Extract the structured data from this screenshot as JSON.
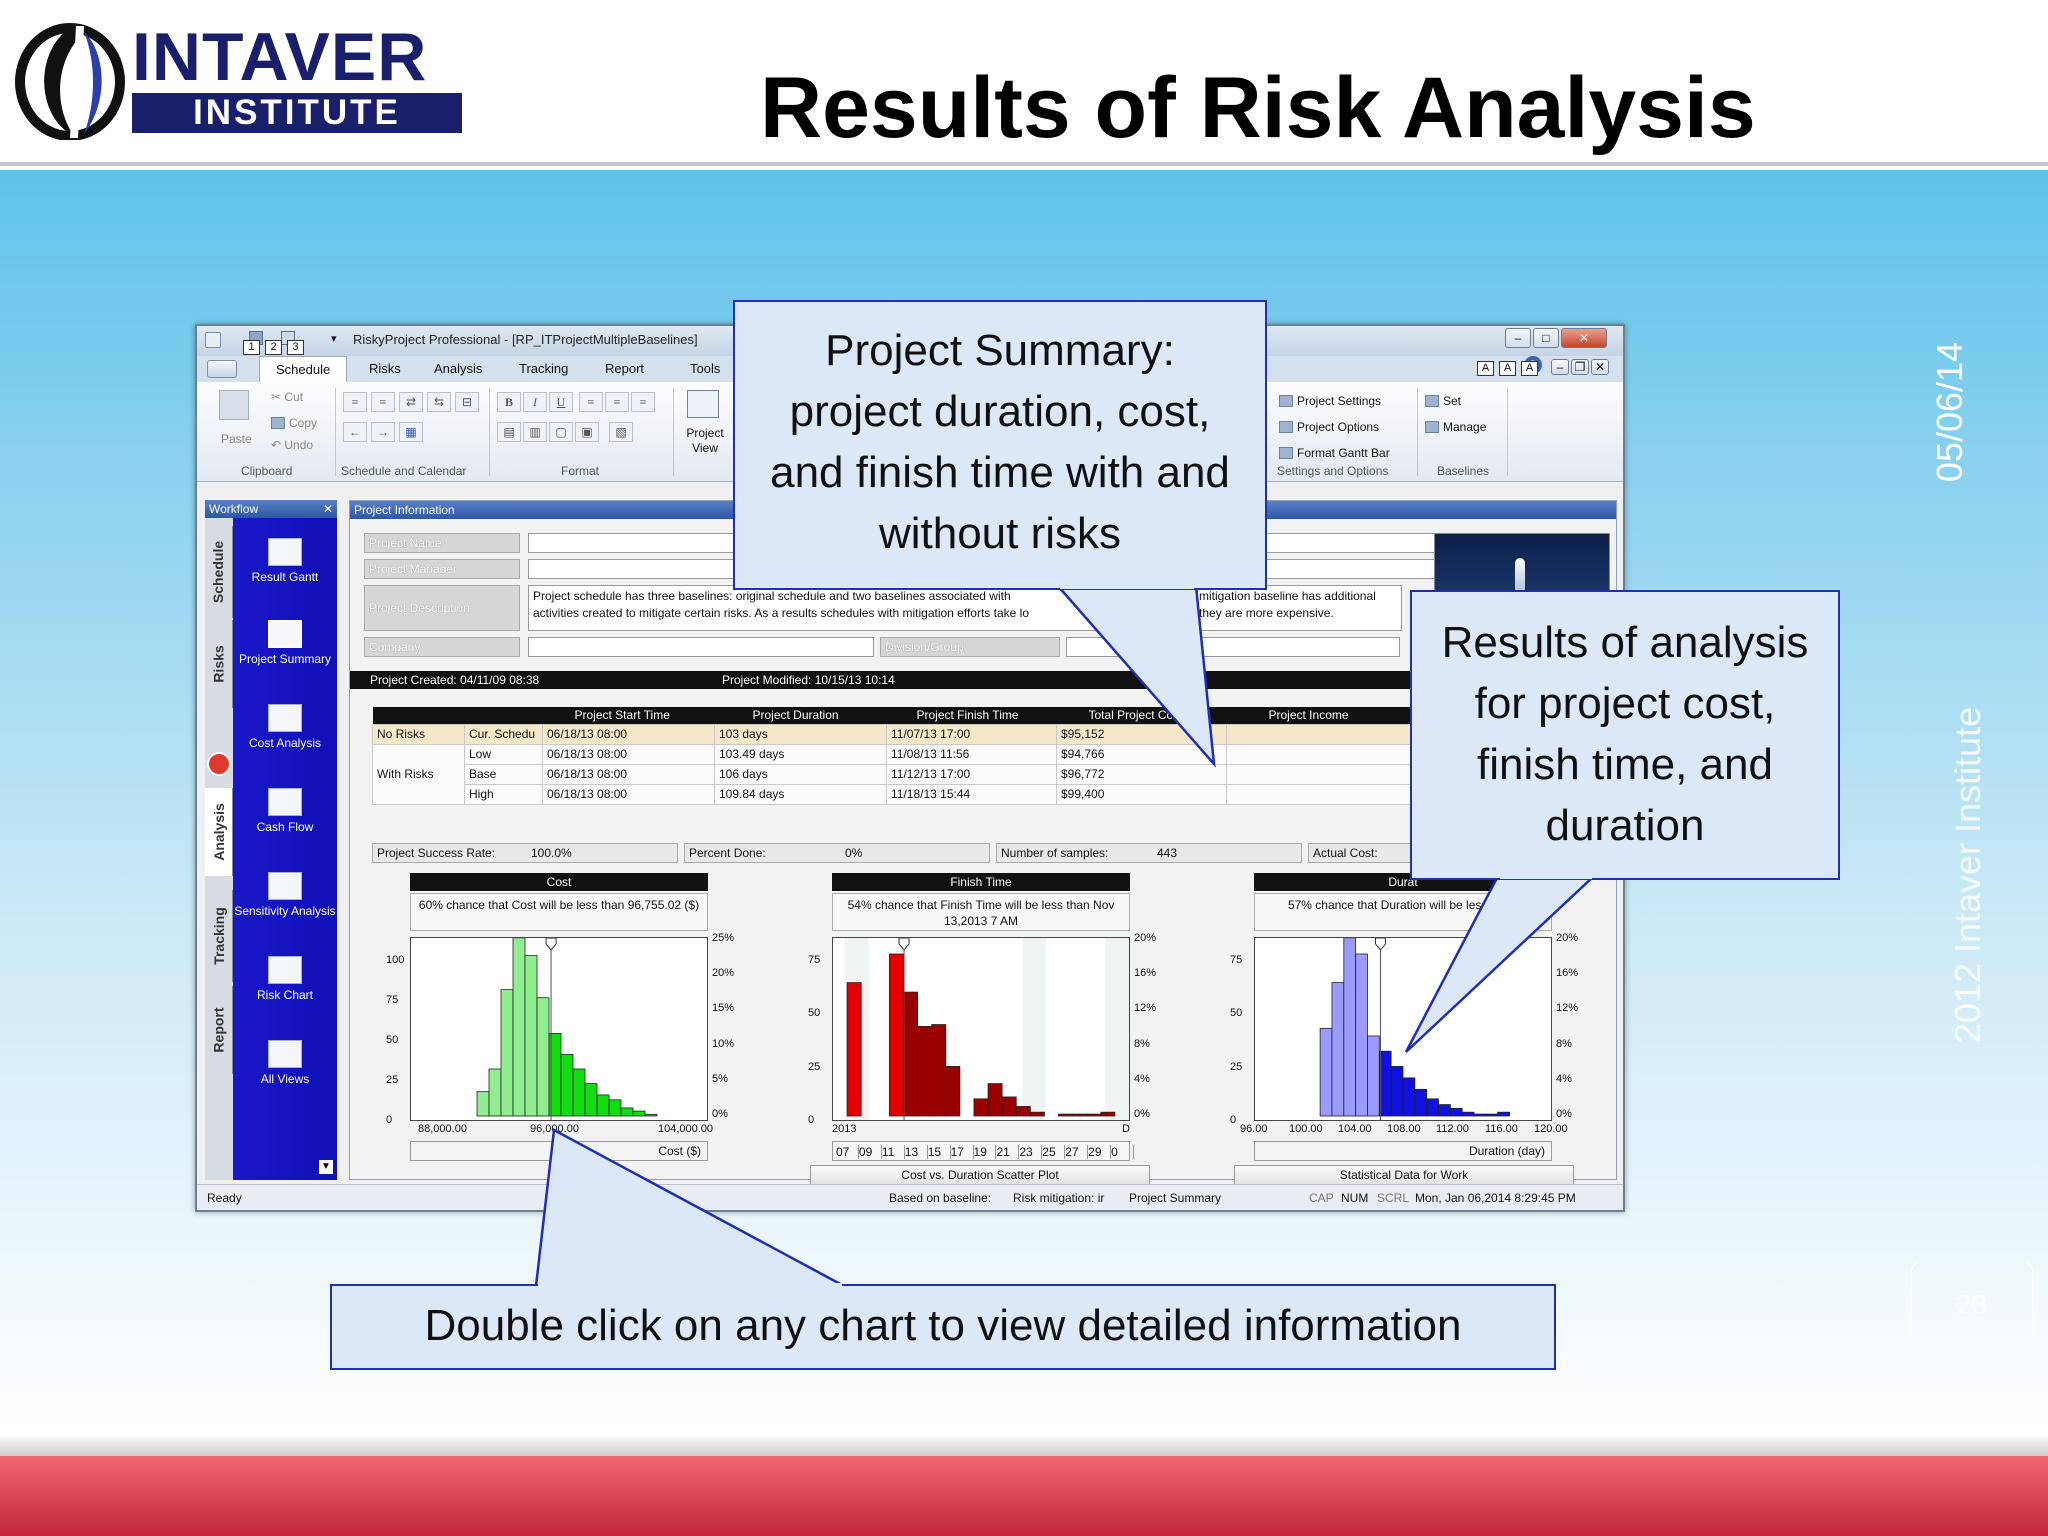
{
  "slide": {
    "title": "Results of Risk Analysis",
    "logo_top": "INTAVER",
    "logo_bottom": "INSTITUTE",
    "date": "05/06/14",
    "copyright": "2012 Intaver Institute",
    "page_number": "23"
  },
  "callouts": {
    "summary": "Project Summary: project duration, cost, and finish time with and without risks",
    "results": "Results of analysis for project cost, finish time, and duration",
    "double_click": "Double click on any chart to view detailed information"
  },
  "app": {
    "title": "RiskyProject Professional - [RP_ITProjectMultipleBaselines]",
    "quick_access": [
      "1",
      "2",
      "3"
    ],
    "window_controls": [
      "–",
      "□",
      "✕"
    ],
    "font_buttons": [
      "A",
      "A",
      "A"
    ],
    "tabs": [
      "Schedule",
      "Risks",
      "Analysis",
      "Tracking",
      "Report",
      "Tools"
    ],
    "ribbon": {
      "paste": "Paste",
      "cut": "Cut",
      "copy": "Copy",
      "undo": "Undo",
      "clipboard": "Clipboard",
      "schedule_calendar": "Schedule and Calendar",
      "format": "Format",
      "bold": "B",
      "italic": "I",
      "underline": "U",
      "project_view": "Project View",
      "project_settings": "Project Settings",
      "project_options": "Project Options",
      "format_gantt": "Format Gantt Bar",
      "settings_options": "Settings and Options",
      "set": "Set",
      "manage": "Manage",
      "baselines": "Baselines"
    },
    "workflow": {
      "header": "Workflow",
      "close": "✕",
      "tabs": [
        "Schedule",
        "Risks",
        "Analysis",
        "Tracking",
        "Report"
      ],
      "items": [
        "Result Gantt",
        "Project Summary",
        "Cost Analysis",
        "Cash Flow",
        "Sensitivity Analysis",
        "Risk Chart",
        "All Views"
      ]
    },
    "project_info": {
      "header": "Project Information",
      "project_name_label": "Project Name",
      "project_manager_label": "Project Manager",
      "project_description_label": "Project Description",
      "description_line1": "Project schedule has three baselines: original schedule and two baselines associated with",
      "description_line1b": "h mitigation baseline has additional",
      "description_line2": "activities created to mitigate certain risks. As a results schedules with mitigation efforts take lo",
      "description_line2b": "d they are more expensive.",
      "company_label": "Company",
      "division_label": "Division/Group",
      "created": "Project Created: 04/11/09 08:38",
      "modified": "Project Modified: 10/15/13 10:14"
    },
    "summary_table": {
      "headers": [
        "",
        "",
        "Project Start Time",
        "Project Duration",
        "Project Finish Time",
        "Total Project Co",
        "Project Income"
      ],
      "rows": [
        [
          "No Risks",
          "Cur. Schedu",
          "06/18/13 08:00",
          "103 days",
          "11/07/13 17:00",
          "$95,152",
          ""
        ],
        [
          "",
          "Low",
          "06/18/13 08:00",
          "103.49 days",
          "11/08/13 11:56",
          "$94,766",
          ""
        ],
        [
          "With Risks",
          "Base",
          "06/18/13 08:00",
          "106 days",
          "11/12/13 17:00",
          "$96,772",
          ""
        ],
        [
          "",
          "High",
          "06/18/13 08:00",
          "109.84 days",
          "11/18/13 15:44",
          "$99,400",
          ""
        ]
      ]
    },
    "stats": {
      "success_label": "Project Success Rate:",
      "success_value": "100.0%",
      "percent_label": "Percent Done:",
      "percent_value": "0%",
      "samples_label": "Number of samples:",
      "samples_value": "443",
      "actual_label": "Actual Cost:"
    },
    "charts": {
      "cost": {
        "title": "Cost",
        "info": "60% chance that Cost will be less than 96,755.02 ($)",
        "xlabel": "Cost ($)",
        "yticks": [
          "100",
          "75",
          "50",
          "25",
          "0"
        ],
        "pticks": [
          "25%",
          "20%",
          "15%",
          "10%",
          "5%",
          "0%"
        ],
        "xticks": [
          "88,000.00",
          "96,000.00",
          "104,000.00"
        ],
        "color_light": "#90ee90",
        "color_dark": "#11dd11"
      },
      "finish": {
        "title": "Finish Time",
        "info": "54% chance that Finish Time will be less than Nov 13,2013 7 AM",
        "xlabel": "Cost vs. Duration Scatter Plot",
        "yticks": [
          "75",
          "50",
          "25",
          "0"
        ],
        "pticks": [
          "20%",
          "16%",
          "12%",
          "8%",
          "4%",
          "0%"
        ],
        "xtick_year": "2013",
        "xtick_end": "D",
        "days": [
          "07",
          "09",
          "11",
          "13",
          "15",
          "17",
          "19",
          "21",
          "23",
          "25",
          "27",
          "29",
          "0"
        ],
        "color_light": "#e00000",
        "color_dark": "#9b0000"
      },
      "duration": {
        "title": "Durat",
        "info": "57% chance that Duration will be less (day)",
        "xlabel": "Duration (day)",
        "button": "Statistical Data for Work",
        "yticks": [
          "75",
          "50",
          "25",
          "0"
        ],
        "pticks": [
          "20%",
          "16%",
          "12%",
          "8%",
          "4%",
          "0%"
        ],
        "xticks": [
          "96.00",
          "100.00",
          "104.00",
          "108.00",
          "112.00",
          "116.00",
          "120.00"
        ],
        "color_light": "#9a9aff",
        "color_dark": "#1010e0"
      }
    },
    "chart_data": [
      {
        "type": "bar",
        "title": "Cost",
        "xlabel": "Cost ($)",
        "x": [
          92500,
          93250,
          94000,
          94750,
          95500,
          96250,
          97000,
          97750,
          98500,
          99250,
          100000,
          100750,
          101500,
          102250,
          103000
        ],
        "values": [
          15,
          29,
          78,
          112,
          99,
          73,
          51,
          38,
          29,
          20,
          13,
          10,
          5,
          3,
          1
        ],
        "threshold_index": 5,
        "xlim": [
          88000,
          106500
        ],
        "ylim": [
          0,
          100
        ]
      },
      {
        "type": "bar",
        "title": "Finish Time",
        "x": [
          "07",
          "08",
          "09",
          "10",
          "11",
          "12",
          "13",
          "14",
          "15",
          "16",
          "17",
          "18",
          "19",
          "20",
          "21",
          "22",
          "23",
          "24",
          "25",
          "26",
          "27"
        ],
        "values": [
          0,
          70,
          0,
          0,
          85,
          65,
          47,
          48,
          26,
          0,
          9,
          17,
          10,
          5,
          2,
          0,
          1,
          1,
          1,
          2,
          0
        ],
        "ylim": [
          0,
          85
        ]
      },
      {
        "type": "bar",
        "title": "Duration",
        "xlabel": "Duration (day)",
        "x": [
          102,
          103,
          104,
          105,
          106,
          107,
          108,
          109,
          110,
          111,
          112,
          113,
          114,
          115,
          116,
          117
        ],
        "values": [
          46,
          70,
          95,
          85,
          42,
          34,
          26,
          20,
          14,
          9,
          6,
          4,
          2,
          1,
          1,
          2
        ],
        "threshold_index": 4,
        "xlim": [
          96,
          121
        ],
        "ylim": [
          0,
          85
        ]
      }
    ],
    "status": {
      "ready": "Ready",
      "baseline": "Based on baseline:",
      "mitigation": "Risk mitigation: ir",
      "view": "Project Summary",
      "cap": "CAP",
      "num": "NUM",
      "scrl": "SCRL",
      "datetime": "Mon, Jan 06,2014  8:29:45 PM"
    }
  }
}
